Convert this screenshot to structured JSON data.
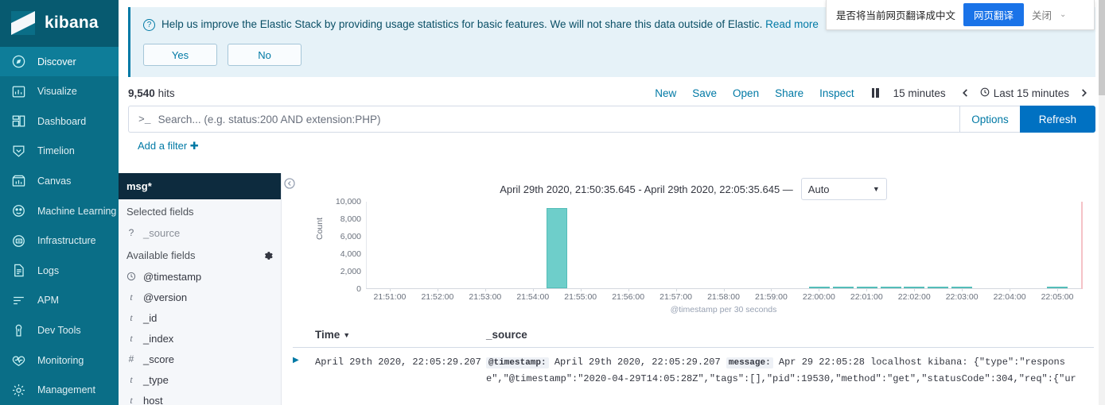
{
  "brand": {
    "name": "kibana",
    "logo_icon": "kibana-logo"
  },
  "sidebar": {
    "items": [
      {
        "label": "Discover",
        "icon": "discover-compass-icon",
        "active": true
      },
      {
        "label": "Visualize",
        "icon": "visualize-bar-chart-icon",
        "active": false
      },
      {
        "label": "Dashboard",
        "icon": "dashboard-grid-icon",
        "active": false
      },
      {
        "label": "Timelion",
        "icon": "timelion-shield-icon",
        "active": false
      },
      {
        "label": "Canvas",
        "icon": "canvas-icon",
        "active": false
      },
      {
        "label": "Machine Learning",
        "icon": "machine-learning-icon",
        "active": false
      },
      {
        "label": "Infrastructure",
        "icon": "infrastructure-icon",
        "active": false
      },
      {
        "label": "Logs",
        "icon": "logs-document-icon",
        "active": false
      },
      {
        "label": "APM",
        "icon": "apm-lines-icon",
        "active": false
      },
      {
        "label": "Dev Tools",
        "icon": "dev-tools-wrench-icon",
        "active": false
      },
      {
        "label": "Monitoring",
        "icon": "monitoring-heartbeat-icon",
        "active": false
      },
      {
        "label": "Management",
        "icon": "management-gear-icon",
        "active": false
      }
    ]
  },
  "banner": {
    "icon": "question-circle-icon",
    "text": "Help us improve the Elastic Stack by providing usage statistics for basic features. We will not share this data outside of Elastic. ",
    "link": "Read more",
    "yes_label": "Yes",
    "no_label": "No",
    "accent": "#0079a5",
    "background": "#e6f2f8"
  },
  "translate_popup": {
    "message": "是否将当前网页翻译成中文",
    "translate_label": "网页翻译",
    "close_label": "关闭",
    "caret_icon": "chevron-down-icon",
    "button_color": "#1a73e8"
  },
  "toolbar": {
    "hits_count": "9,540",
    "hits_label": "hits",
    "actions": [
      "New",
      "Save",
      "Open",
      "Share",
      "Inspect"
    ],
    "pause_icon": "pause-icon",
    "refresh_interval": "15 minutes",
    "prev_icon": "chevron-left-icon",
    "next_icon": "chevron-right-icon",
    "clock_icon": "clock-icon",
    "time_range_label": "Last 15 minutes"
  },
  "search": {
    "prompt_icon": "terminal-prompt-icon",
    "value": "",
    "placeholder": "Search... (e.g. status:200 AND extension:PHP)",
    "options_label": "Options",
    "refresh_label": "Refresh",
    "refresh_color": "#0071c2"
  },
  "filters": {
    "add_filter_label": "Add a filter",
    "add_icon": "plus-icon"
  },
  "fields": {
    "index_pattern": "msg*",
    "selected_title": "Selected fields",
    "available_title": "Available fields",
    "gear_icon": "gear-icon",
    "selected": [
      {
        "name": "_source",
        "type": "?"
      }
    ],
    "available": [
      {
        "name": "@timestamp",
        "type": "clock"
      },
      {
        "name": "@version",
        "type": "t"
      },
      {
        "name": "_id",
        "type": "t"
      },
      {
        "name": "_index",
        "type": "t"
      },
      {
        "name": "_score",
        "type": "#"
      },
      {
        "name": "_type",
        "type": "t"
      },
      {
        "name": "host",
        "type": "t"
      }
    ]
  },
  "chart_header": {
    "collapse_icon": "collapse-left-icon",
    "time_range": "April 29th 2020, 21:50:35.645 - April 29th 2020, 22:05:35.645 —",
    "interval_value": "Auto",
    "interval_caret": "chevron-down-icon"
  },
  "chart_data": {
    "type": "bar",
    "title": "",
    "xlabel": "@timestamp per 30 seconds",
    "ylabel": "Count",
    "ylim": [
      0,
      10000
    ],
    "yticks": [
      0,
      2000,
      4000,
      6000,
      8000,
      10000
    ],
    "ytick_labels": [
      "0",
      "2,000",
      "4,000",
      "6,000",
      "8,000",
      "10,000"
    ],
    "xtick_labels": [
      "21:51:00",
      "21:52:00",
      "21:53:00",
      "21:54:00",
      "21:55:00",
      "21:56:00",
      "21:57:00",
      "21:58:00",
      "21:59:00",
      "22:00:00",
      "22:01:00",
      "22:02:00",
      "22:03:00",
      "22:04:00",
      "22:05:00"
    ],
    "bar_color": "#6ececa",
    "bar_border_color": "#54bdb8",
    "grid": false,
    "legend": "none",
    "categories": [
      "21:54:30",
      "22:00:00",
      "22:00:30",
      "22:01:00",
      "22:01:30",
      "22:02:00",
      "22:02:30",
      "22:03:00",
      "22:05:00"
    ],
    "values": [
      9200,
      40,
      70,
      130,
      40,
      60,
      60,
      120,
      110
    ],
    "bars": [
      {
        "x": "21:54:30",
        "value": 9200
      },
      {
        "x": "22:00:00",
        "value": 40
      },
      {
        "x": "22:00:30",
        "value": 70
      },
      {
        "x": "22:01:00",
        "value": 130
      },
      {
        "x": "22:01:30",
        "value": 40
      },
      {
        "x": "22:02:00",
        "value": 60
      },
      {
        "x": "22:02:30",
        "value": 60
      },
      {
        "x": "22:03:00",
        "value": 120
      },
      {
        "x": "22:05:00",
        "value": 110
      }
    ]
  },
  "doc_table": {
    "expand_icon": "expand-row-icon",
    "col_time": "Time",
    "sort_icon": "sort-caret-icon",
    "col_source": "_source",
    "rows": [
      {
        "time": "April 29th 2020, 22:05:29.207",
        "source_line1_key1": "@timestamp:",
        "source_line1_val1": "April 29th 2020, 22:05:29.207",
        "source_line1_key2": "message:",
        "source_line1_val2": "Apr 29 22:05:28 localhost kibana: {\"type\":\"respons",
        "source_line2": "e\",\"@timestamp\":\"2020-04-29T14:05:28Z\",\"tags\":[],\"pid\":19530,\"method\":\"get\",\"statusCode\":304,\"req\":{\"ur"
      }
    ]
  }
}
